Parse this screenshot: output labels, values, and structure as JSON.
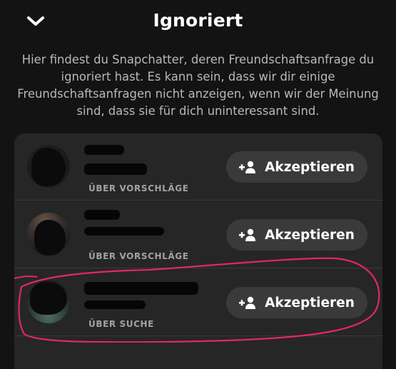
{
  "header": {
    "title": "Ignoriert",
    "back_icon": "chevron-down-icon"
  },
  "description": "Hier findest du Snapchatter, deren Freundschaftsanfrage du ignoriert hast. Es kann sein, dass wir dir einige Freundschaftsanfragen nicht anzeigen, wenn wir der Meinung sind, dass sie für dich uninteressant sind.",
  "requests": [
    {
      "source": "ÜBER VORSCHLÄGE",
      "action": "Akzeptieren",
      "action_icon": "add-friend-icon"
    },
    {
      "source": "ÜBER VORSCHLÄGE",
      "action": "Akzeptieren",
      "action_icon": "add-friend-icon"
    },
    {
      "source": "ÜBER SUCHE",
      "action": "Akzeptieren",
      "action_icon": "add-friend-icon"
    }
  ],
  "colors": {
    "background": "#131313",
    "card": "#262626",
    "button": "#3a3a3a",
    "annotation": "#e0295e"
  }
}
